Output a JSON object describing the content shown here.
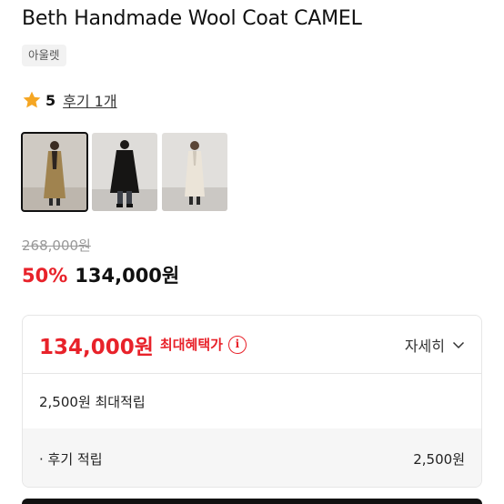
{
  "product": {
    "title": "Beth Handmade Wool Coat CAMEL",
    "badge": "아울렛"
  },
  "rating": {
    "score": "5",
    "review_link": "후기 1개",
    "icon": "star-icon",
    "star_color": "#f5a623"
  },
  "thumbnails": [
    {
      "name": "thumbnail-camel",
      "selected": true
    },
    {
      "name": "thumbnail-black",
      "selected": false
    },
    {
      "name": "thumbnail-ivory",
      "selected": false
    }
  ],
  "price": {
    "original": "268,000원",
    "discount": "50%",
    "sale": "134,000원"
  },
  "benefit": {
    "max_price": "134,000원",
    "max_label": "최대혜택가",
    "detail_label": "자세히",
    "points_total": "2,500원 최대적립",
    "review_points_label": "· 후기 적립",
    "review_points_value": "2,500원"
  },
  "colors": {
    "accent_red": "#e8222a",
    "text": "#111111"
  }
}
